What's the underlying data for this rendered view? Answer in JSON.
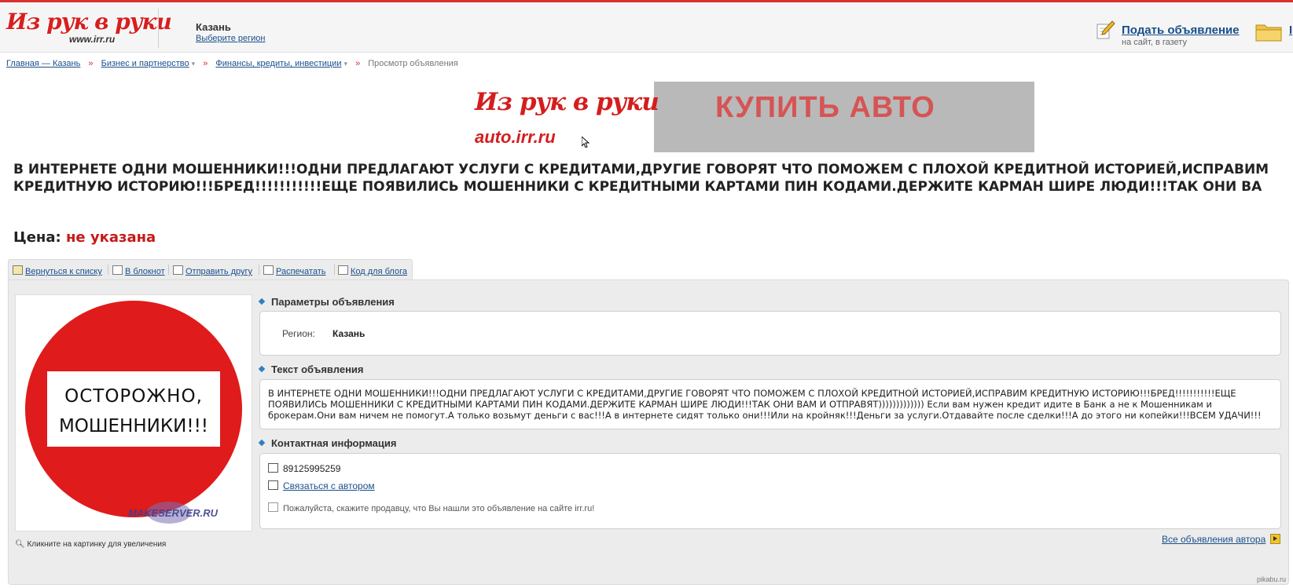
{
  "header": {
    "logo_text": "Из рук в руки",
    "logo_sub": "www.irr.ru",
    "city": "Казань",
    "choose_region": "Выберите регион",
    "submit_ad": "Подать объявление",
    "submit_ad_sub": "на сайт, в газету",
    "folder_label": "I"
  },
  "breadcrumbs": [
    {
      "label": "Главная — Казань"
    },
    {
      "label": "Бизнес и партнерство"
    },
    {
      "label": "Финансы, кредиты, инвестиции"
    },
    {
      "label": "Просмотр объявления"
    }
  ],
  "banner": {
    "logo": "Из рук в руки",
    "url": "auto.irr.ru",
    "title": "КУПИТЬ АВТО"
  },
  "ad": {
    "title": "В ИНТЕРНЕТЕ ОДНИ МОШЕННИКИ!!!ОДНИ ПРЕДЛАГАЮТ УСЛУГИ С КРЕДИТАМИ,ДРУГИЕ ГОВОРЯТ ЧТО ПОМОЖЕМ С ПЛОХОЙ КРЕДИТНОЙ ИСТОРИЕЙ,ИСПРАВИМ КРЕДИТНУЮ ИСТОРИЮ!!!БРЕД!!!!!!!!!!!ЕЩЕ ПОЯВИЛИСЬ МОШЕННИКИ С КРЕДИТНЫМИ КАРТАМИ ПИН КОДАМИ.ДЕРЖИТЕ КАРМАН ШИРЕ ЛЮДИ!!!ТАК ОНИ ВА",
    "price_label": "Цена:",
    "price_value": "не указана"
  },
  "toolbar": {
    "back": "Вернуться к списку",
    "notebook": "В блокнот",
    "send_friend": "Отправить другу",
    "print": "Распечатать",
    "blog_code": "Код для блога"
  },
  "photo": {
    "sign_line1": "ОСТОРОЖНО,",
    "sign_line2": "МОШЕННИКИ!!!",
    "watermark_text": "MAKESERVER.RU",
    "enlarge_hint": "Кликните на картинку для увеличения"
  },
  "params": {
    "heading": "Параметры объявления",
    "region_label": "Регион:",
    "region_value": "Казань"
  },
  "text_section": {
    "heading": "Текст объявления",
    "body": "В ИНТЕРНЕТЕ ОДНИ МОШЕННИКИ!!!ОДНИ ПРЕДЛАГАЮТ УСЛУГИ С КРЕДИТАМИ,ДРУГИЕ ГОВОРЯТ ЧТО ПОМОЖЕМ С ПЛОХОЙ КРЕДИТНОЙ ИСТОРИЕЙ,ИСПРАВИМ КРЕДИТНУЮ ИСТОРИЮ!!!БРЕД!!!!!!!!!!!ЕЩЕ ПОЯВИЛИСЬ МОШЕННИКИ С КРЕДИТНЫМИ КАРТАМИ ПИН КОДАМИ.ДЕРЖИТЕ КАРМАН ШИРЕ ЛЮДИ!!!ТАК ОНИ ВАМ И ОТПРАВЯТ))))))))))))) Если вам нужен кредит идите в Банк а не к Мошенникам и брокерам.Они вам ничем не помогут.А только возьмут деньги с вас!!!А в интернете сидят только они!!!Или на кройняк!!!Деньги за услуги.Отдавайте после сделки!!!А до этого ни копейки!!!ВСЕМ УДАЧИ!!!"
  },
  "contact": {
    "heading": "Контактная информация",
    "phone": "89125995259",
    "contact_author": "Связаться с автором",
    "notice": "Пожалуйста, скажите продавцу, что Вы нашли это объявление на сайте irr.ru!"
  },
  "all_ads": "Все объявления автора",
  "watermark": "pikabu.ru",
  "colors": {
    "brand_red": "#d62020",
    "link_blue": "#1a4f8b",
    "price_red": "#c81818",
    "section_diamond": "#2f7fc4"
  }
}
